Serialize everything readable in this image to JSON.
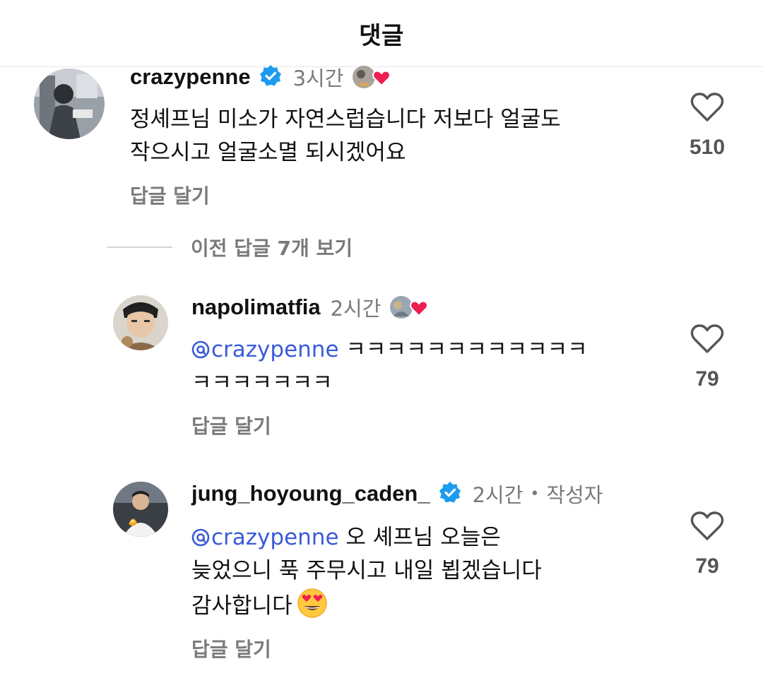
{
  "header": {
    "title": "댓글"
  },
  "comments": [
    {
      "username": "crazypenne",
      "verified": true,
      "time": "3시간",
      "text_lines": [
        "정셰프님 미소가 자연스럽습니다 저보다 얼굴도",
        "작으시고 얼굴소멸 되시겠어요"
      ],
      "reply_label": "답글 달기",
      "likes": "510"
    }
  ],
  "view_previous": {
    "label": "이전 답글 7개 보기"
  },
  "replies": [
    {
      "username": "napolimatfia",
      "verified": false,
      "time": "2시간",
      "mention": "crazypenne",
      "text_lines": [
        " ㅋㅋㅋㅋㅋㅋㅋㅋㅋㅋㅋㅋ",
        "ㅋㅋㅋㅋㅋㅋㅋ"
      ],
      "reply_label": "답글 달기",
      "likes": "79"
    },
    {
      "username": "jung_hoyoung_caden_",
      "verified": true,
      "time": "2시간",
      "author_sep": "•",
      "author_label": "작성자",
      "mention": "crazypenne",
      "text_lines": [
        " 오 셰프님 오늘은",
        "늦었으니 푹 주무시고 내일 뵙겠습니다",
        "감사합니다"
      ],
      "emoji": "heart-eyes-emoji",
      "reply_label": "답글 달기",
      "likes": "79"
    }
  ],
  "colors": {
    "mention": "#3a5bd9",
    "verified": "#1d9bf0",
    "heart": "#ee1d52",
    "muted": "#7a7a7a"
  }
}
